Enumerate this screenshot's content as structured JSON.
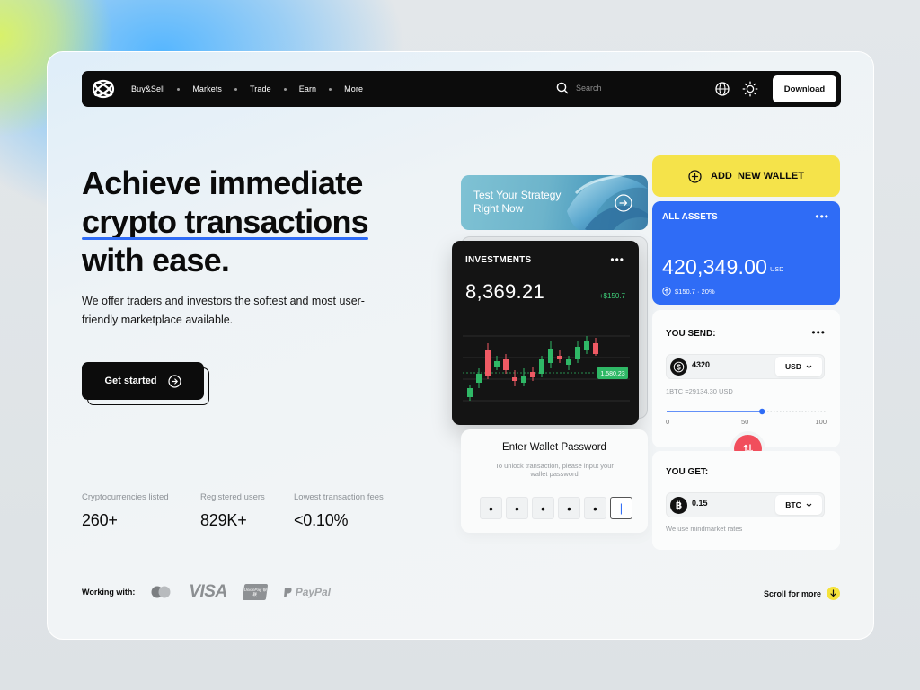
{
  "nav": {
    "items": [
      "Buy&Sell",
      "Markets",
      "Trade",
      "Earn",
      "More"
    ],
    "search_placeholder": "Search",
    "download_label": "Download"
  },
  "hero": {
    "headline_line1": "Achieve immediate",
    "headline_line2": "crypto transactions",
    "headline_line3": "with ease.",
    "subtext": "We offer traders and investors the softest and most user-friendly marketplace available.",
    "cta_label": "Get started"
  },
  "stats": [
    {
      "label": "Cryptocurrencies listed",
      "value": "260+"
    },
    {
      "label": "Registered users",
      "value": "829K+"
    },
    {
      "label": "Lowest transaction fees",
      "value": "<0.10%"
    }
  ],
  "partners": {
    "label": "Working with:",
    "names": [
      "VISA",
      "PayPal"
    ],
    "unionpay_text": "UnionPay 银联"
  },
  "scroll_more": "Scroll for more",
  "strategy": {
    "title_line1": "Test Your Strategy",
    "title_line2": "Right Now"
  },
  "investments": {
    "title": "INVESTMENTS",
    "value": "8,369.21",
    "change": "+$150.7",
    "price_tag": "1,580.23"
  },
  "password": {
    "title": "Enter Wallet Password",
    "subtitle": "To unlock transaction, please input your wallet password",
    "masked": [
      "•",
      "•",
      "•",
      "•",
      "•",
      "|"
    ]
  },
  "wallet": {
    "add_label": "ADD  NEW WALLET"
  },
  "assets": {
    "title": "ALL ASSETS",
    "value": "420,349.00",
    "currency": "USD",
    "change": "$150.7 · 20%"
  },
  "send": {
    "title": "YOU SEND:",
    "amount": "4320",
    "currency": "USD",
    "rate": "1BTC =29134.30 USD",
    "slider_labels": [
      "0",
      "50",
      "100"
    ],
    "slider_value": 0.6
  },
  "get": {
    "title": "YOU GET:",
    "amount": "0.15",
    "currency": "BTC",
    "note": "We use mindmarket rates"
  },
  "colors": {
    "accent_blue": "#2f6cf6",
    "accent_yellow": "#f5e34a",
    "swap_red": "#f14e5c",
    "candle_up": "#2fb866",
    "candle_down": "#ef5a64"
  }
}
